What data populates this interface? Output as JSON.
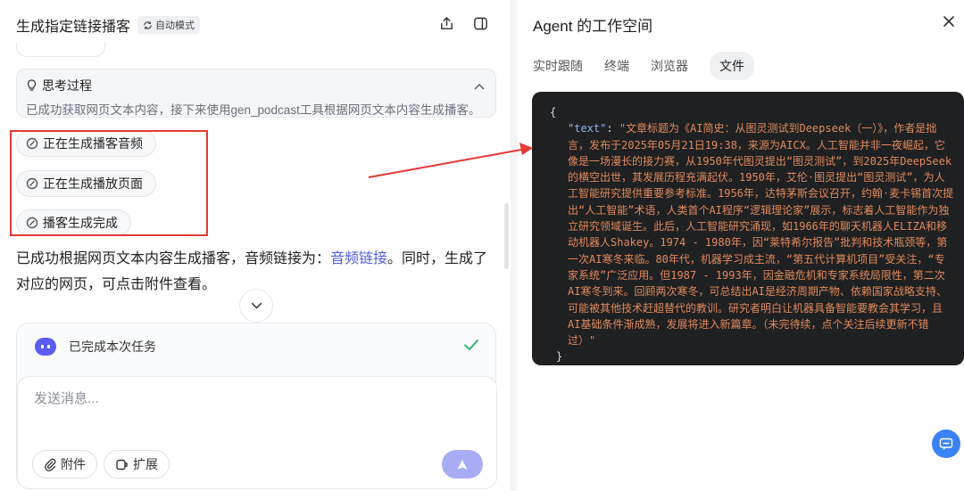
{
  "left": {
    "title": "生成指定链接播客",
    "mode_badge": "自动模式",
    "thinking": {
      "title": "思考过程",
      "text": "已成功获取网页文本内容，接下来使用gen_podcast工具根据网页文本内容生成播客。"
    },
    "steps": [
      {
        "label": "正在生成播客音频"
      },
      {
        "label": "正在生成播放页面"
      },
      {
        "label": "播客生成完成"
      }
    ],
    "answer": {
      "part1": "已成功根据网页文本内容生成播客，音频链接为：",
      "link": "音频链接",
      "part2": "。同时，生成了对应的网页，可点击附件查看。"
    },
    "task_status": "已完成本次任务",
    "input": {
      "placeholder": "发送消息..."
    },
    "buttons": {
      "attach": "附件",
      "extend": "扩展"
    }
  },
  "right": {
    "title": "Agent 的工作空间",
    "tabs": [
      "实时跟随",
      "终端",
      "浏览器",
      "文件"
    ],
    "active_tab": "文件",
    "code": {
      "open_brace": "{",
      "key": "\"text\"",
      "colon": ": ",
      "value": "\"文章标题为《AI简史：从图灵测试到Deepseek（一）》，作者是拙言，发布于2025年05月21日19:38，来源为AICX。人工智能并非一夜崛起，它像是一场漫长的接力赛，从1950年代图灵提出“图灵测试”，到2025年DeepSeek的横空出世，其发展历程充满起伏。1950年，艾伦·图灵提出“图灵测试”，为人工智能研究提供重要参考标准。1956年，达特茅斯会议召开，约翰·麦卡锡首次提出“人工智能”术语，人类首个AI程序“逻辑理论家”展示，标志着人工智能作为独立研究领域诞生。此后，人工智能研究涌现，如1966年的聊天机器人ELIZA和移动机器人Shakey。1974 - 1980年，因“莱特希尔报告”批判和技术瓶颈等，第一次AI寒冬来临。80年代，机器学习成主流，“第五代计算机项目”受关注，“专家系统”广泛应用。但1987 - 1993年，因金融危机和专家系统局限性，第二次AI寒冬到来。回顾两次寒冬，可总结出AI是经济周期产物、依赖国家战略支持、可能被其他技术赶超替代的教训。研究者明白让机器具备智能要教会其学习，且AI基础条件渐成熟，发展将进入新篇章。（未完待续，点个关注后续更新不错过）\"",
      "close_brace": "}"
    }
  },
  "colors": {
    "accent": "#4e5fe3",
    "annotation_red": "#e53935",
    "code_bg": "#1f2021",
    "code_string": "#e08a5e",
    "code_key": "#8fb6f0",
    "check_green": "#2bb673"
  }
}
